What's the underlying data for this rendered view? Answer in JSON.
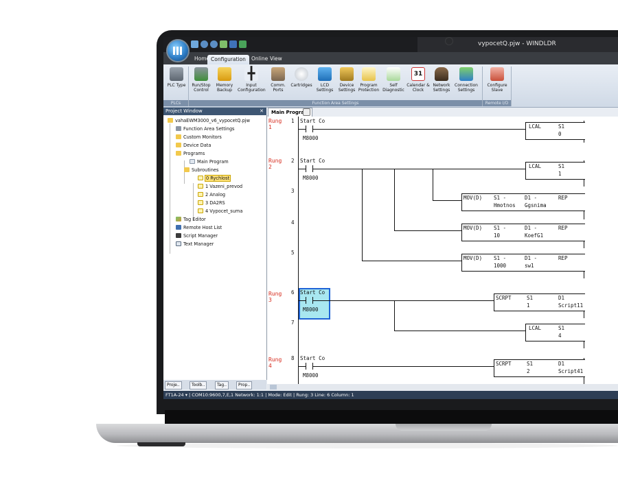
{
  "window": {
    "title": "vypocetQ.pjw - WINDLDR"
  },
  "menu_tabs": [
    "Home",
    "Configuration",
    "Online",
    "View"
  ],
  "active_tab": "Configuration",
  "ribbon": {
    "buttons": [
      {
        "label": "PLC Type",
        "icon": "plc-icon"
      },
      {
        "label": "Run/Stop Control",
        "icon": "run-stop-icon"
      },
      {
        "label": "Memory Backup",
        "icon": "memory-backup-icon"
      },
      {
        "label": "Input Configuration",
        "icon": "input-config-icon"
      },
      {
        "label": "Comm. Ports",
        "icon": "comm-ports-icon"
      },
      {
        "label": "Cartridges",
        "icon": "cartridges-icon"
      },
      {
        "label": "LCD Settings",
        "icon": "lcd-icon"
      },
      {
        "label": "Device Settings",
        "icon": "device-settings-icon"
      },
      {
        "label": "Program Protection",
        "icon": "program-protection-icon"
      },
      {
        "label": "Self Diagnostic",
        "icon": "self-diagnostic-icon"
      },
      {
        "label": "Calendar & Clock",
        "icon": "calendar-icon"
      },
      {
        "label": "Network Settings",
        "icon": "network-icon"
      },
      {
        "label": "Connection Settings",
        "icon": "connection-icon"
      },
      {
        "label": "Configure Slave",
        "icon": "configure-slave-icon"
      }
    ],
    "calendar_day": "31",
    "groups": [
      "PLCs",
      "Function Area Settings",
      "Remote I/O"
    ]
  },
  "project_window": {
    "title": "Project Window",
    "pin": "✕",
    "tree": [
      {
        "label": "vahaEWM3000_v6_vypocetQ.pjw",
        "level": 0,
        "icon": "folder-icon"
      },
      {
        "label": "Function Area Settings",
        "level": 1,
        "icon": "settings-icon"
      },
      {
        "label": "Custom Monitors",
        "level": 1,
        "icon": "folder-icon"
      },
      {
        "label": "Device Data",
        "level": 1,
        "icon": "folder-icon"
      },
      {
        "label": "Programs",
        "level": 1,
        "icon": "folder-icon"
      },
      {
        "label": "Main Program",
        "level": 2,
        "icon": "program-icon"
      },
      {
        "label": "Subroutines",
        "level": 2,
        "icon": "folder-icon"
      },
      {
        "label": "0 Rychlost",
        "level": 3,
        "icon": "page-icon",
        "selected": true
      },
      {
        "label": "1 Vazeni_prevod",
        "level": 3,
        "icon": "page-icon"
      },
      {
        "label": "2 Analog",
        "level": 3,
        "icon": "page-icon"
      },
      {
        "label": "3 DA2RS",
        "level": 3,
        "icon": "page-icon"
      },
      {
        "label": "4 Vypocet_suma",
        "level": 3,
        "icon": "page-icon"
      },
      {
        "label": "Tag Editor",
        "level": 1,
        "icon": "tag-editor-icon"
      },
      {
        "label": "Remote Host List",
        "level": 1,
        "icon": "remote-host-icon"
      },
      {
        "label": "Script Manager",
        "level": 1,
        "icon": "script-manager-icon"
      },
      {
        "label": "Text Manager",
        "level": 1,
        "icon": "text-manager-icon"
      }
    ],
    "bottom_tabs": [
      "Proje..",
      "Toolb..",
      "Tag..",
      "Prop.."
    ]
  },
  "editor": {
    "tab": "Main Program",
    "rungs": [
      {
        "label": "Rung 1",
        "rung_word": "Rung",
        "rung_num": "1"
      },
      {
        "label": "Rung 2",
        "rung_word": "Rung",
        "rung_num": "2"
      },
      {
        "label": "Rung 3",
        "rung_word": "Rung",
        "rung_num": "3"
      },
      {
        "label": "Rung 4",
        "rung_word": "Rung",
        "rung_num": "4"
      }
    ],
    "lines": [
      "1",
      "2",
      "3",
      "4",
      "5",
      "6",
      "7",
      "8"
    ],
    "contact_name": "Start Co",
    "contact_device": "M8000",
    "instructions": [
      {
        "op": "LCAL",
        "p1": "S1",
        "p1v": "0"
      },
      {
        "op": "LCAL",
        "p1": "S1",
        "p1v": "1"
      },
      {
        "op": "MOV(D)",
        "p1": "S1 -",
        "p1v": "Hmotnos",
        "p2": "D1 -",
        "p2v": "Ggsnima",
        "p3": "REP"
      },
      {
        "op": "MOV(D)",
        "p1": "S1 -",
        "p1v": "10",
        "p2": "D1 -",
        "p2v": "KoefG1",
        "p3": "REP"
      },
      {
        "op": "MOV(D)",
        "p1": "S1 -",
        "p1v": "1000",
        "p2": "D1 -",
        "p2v": "sw1",
        "p3": "REP"
      },
      {
        "op": "SCRPT",
        "p1": "S1",
        "p1v": "1",
        "p2": "D1",
        "p2v": "Script11"
      },
      {
        "op": "LCAL",
        "p1": "S1",
        "p1v": "4"
      },
      {
        "op": "SCRPT",
        "p1": "S1",
        "p1v": "2",
        "p2": "D1",
        "p2v": "Script41"
      }
    ]
  },
  "status_bar": "FT1A-24 ▾  | COM10:9600,7,E,1  Network: 1:1  | Mode: Edit  | Rung: 3  Line: 6  Column: 1"
}
